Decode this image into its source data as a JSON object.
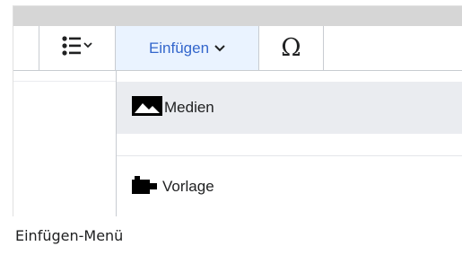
{
  "toolbar": {
    "list_icon": "bullet-list-icon",
    "insert_label": "Einfügen",
    "special_char_label": "Ω"
  },
  "insert_menu": {
    "items": [
      {
        "label": "Medien",
        "icon": "image-icon"
      },
      {
        "label": "Vorlage",
        "icon": "puzzle-icon"
      }
    ]
  },
  "caption": "Einfügen-Menü",
  "colors": {
    "accent": "#3366cc",
    "active_bg": "#eaf3ff",
    "hover_bg": "#eaecf0",
    "border": "#c8ccd1"
  }
}
